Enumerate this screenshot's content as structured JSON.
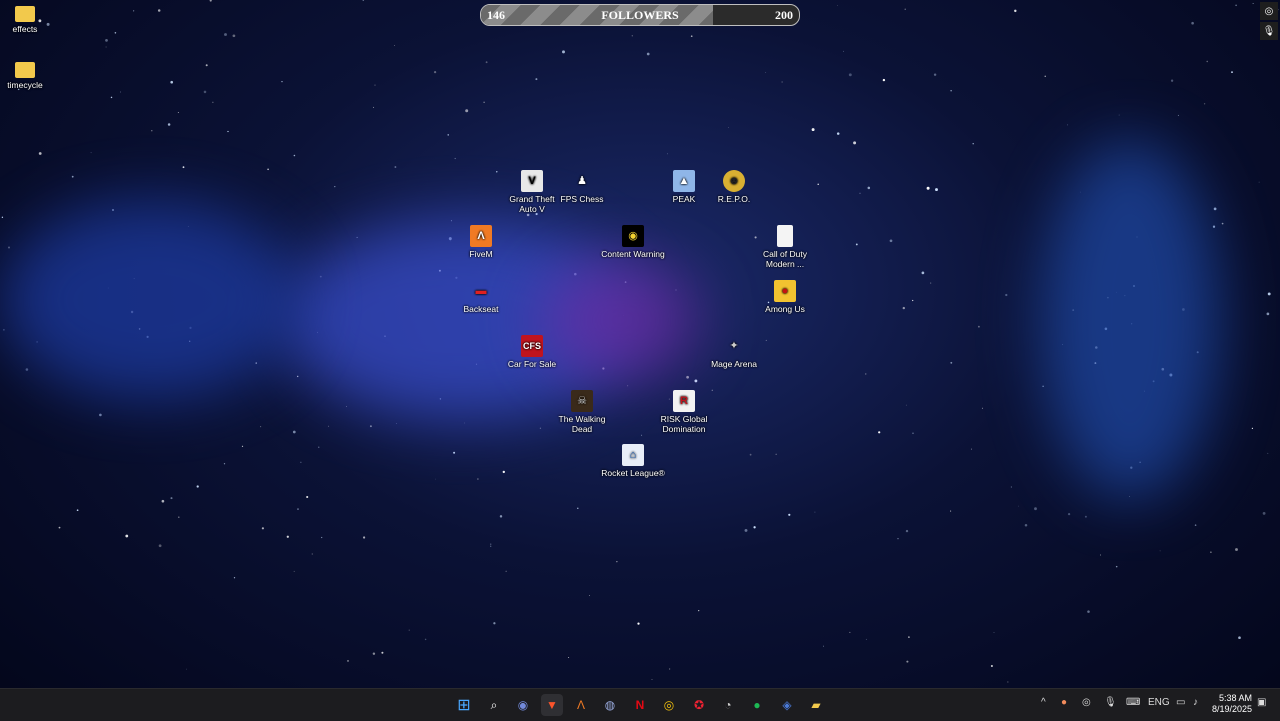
{
  "followers_bar": {
    "current": "146",
    "label": "FOLLOWERS",
    "goal": "200",
    "progress": 0.73
  },
  "desktop_icons": [
    {
      "name": "effects",
      "icon": "folder-icon"
    },
    {
      "name": "timecycle",
      "icon": "folder-icon"
    },
    {
      "name": "Grand Theft Auto V",
      "icon": "gta-icon"
    },
    {
      "name": "FPS Chess",
      "icon": "chess-icon"
    },
    {
      "name": "PEAK",
      "icon": "peak-icon"
    },
    {
      "name": "R.E.P.O.",
      "icon": "repo-icon"
    },
    {
      "name": "FiveM",
      "icon": "fivem-icon"
    },
    {
      "name": "Content Warning",
      "icon": "content-warning-icon"
    },
    {
      "name": "Call of Duty Modern ...",
      "icon": "file-icon"
    },
    {
      "name": "Backseat",
      "icon": "backseat-icon"
    },
    {
      "name": "Among Us",
      "icon": "among-us-icon"
    },
    {
      "name": "Car For Sale",
      "icon": "car-for-sale-icon"
    },
    {
      "name": "Mage Arena",
      "icon": "mage-arena-icon"
    },
    {
      "name": "The Walking Dead",
      "icon": "walking-dead-icon"
    },
    {
      "name": "RISK Global Domination",
      "icon": "risk-icon"
    },
    {
      "name": "Rocket League®",
      "icon": "rocket-league-icon"
    }
  ],
  "taskbar": {
    "apps": [
      "start-icon",
      "search-icon",
      "discord-icon",
      "brave-icon",
      "fivem-icon",
      "steam-icon",
      "netflix-icon",
      "chrome-icon",
      "app-icon",
      "obs-icon",
      "spotify-icon",
      "app-icon",
      "file-explorer-icon"
    ],
    "tray": {
      "language": "ENG",
      "time": "5:38 AM",
      "date": "8/19/2025"
    }
  }
}
